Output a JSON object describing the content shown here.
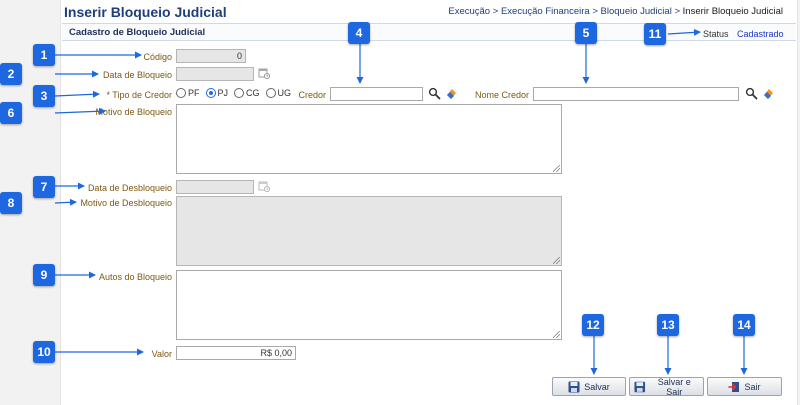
{
  "header": {
    "title": "Inserir Bloqueio Judicial",
    "breadcrumb": [
      "Execução",
      "Execução Financeira",
      "Bloqueio Judicial",
      "Inserir Bloqueio Judicial"
    ],
    "separator": ">"
  },
  "section": {
    "title": "Cadastro de Bloqueio Judicial",
    "status_label": "Status",
    "status_value": "Cadastrado"
  },
  "form": {
    "codigo": {
      "label": "Código",
      "value": "0"
    },
    "data_bloqueio": {
      "label": "Data de Bloqueio",
      "value": ""
    },
    "tipo_credor": {
      "label": "* Tipo de Credor",
      "options": [
        "PF",
        "PJ",
        "CG",
        "UG"
      ],
      "selected": "PJ"
    },
    "credor": {
      "label": "Credor",
      "value": ""
    },
    "nome_credor": {
      "label": "Nome Credor",
      "value": ""
    },
    "motivo_bloqueio": {
      "label": "Motivo de Bloqueio",
      "value": ""
    },
    "data_desbloqueio": {
      "label": "Data de Desbloqueio",
      "value": ""
    },
    "motivo_desbloqueio": {
      "label": "Motivo de Desbloqueio",
      "value": ""
    },
    "autos_bloqueio": {
      "label": "Autos do Bloqueio",
      "value": ""
    },
    "valor": {
      "label": "Valor",
      "value": "R$ 0,00"
    }
  },
  "buttons": {
    "salvar": "Salvar",
    "salvar_sair": "Salvar e Sair",
    "sair": "Sair"
  },
  "annotations": [
    "1",
    "2",
    "3",
    "4",
    "5",
    "6",
    "7",
    "8",
    "9",
    "10",
    "11",
    "12",
    "13",
    "14"
  ],
  "icons": {
    "calendar": "calendar-icon",
    "search": "magnifier-icon",
    "clear": "eraser-icon",
    "save": "floppy-icon",
    "exit": "exit-icon"
  },
  "colors": {
    "title": "#1f3e7c",
    "label": "#7a5a12",
    "badge": "#1d67e0",
    "status_value": "#1a35c9"
  }
}
